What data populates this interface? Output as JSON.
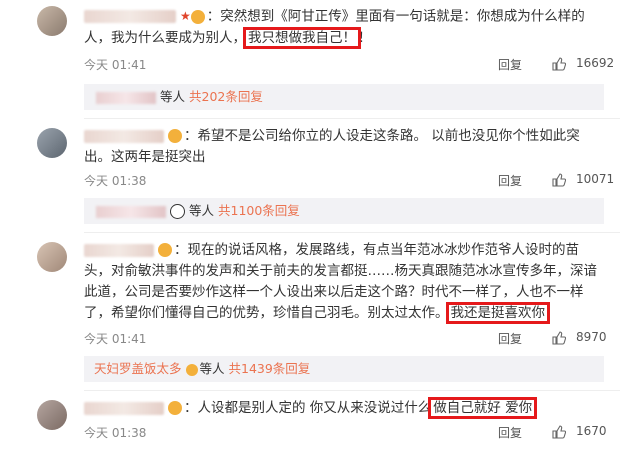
{
  "comments": [
    {
      "text_before": "突然想到《阿甘正传》里面有一句话就是：你想成为什么样的人，我为什么要成为别人，",
      "highlight": "我只想做我自己！",
      "text_after": "！",
      "time": "今天 01:41",
      "reply_label": "回复",
      "likes": "16692",
      "sub": {
        "suffix": "等人",
        "count_link": "共202条回复"
      }
    },
    {
      "text_before": "希望不是公司给你立的人设走这条路。 以前也没见你个性如此突出。这两年是挺突出",
      "highlight": "",
      "text_after": "",
      "time": "今天 01:38",
      "reply_label": "回复",
      "likes": "10071",
      "sub": {
        "suffix": "等人",
        "count_link": "共1100条回复"
      }
    },
    {
      "text_before": "现在的说话风格，发展路线，有点当年范冰冰炒作范爷人设时的苗头，对俞敏洪事件的发声和关于前夫的发言都挺……杨天真跟随范冰冰宣传多年，深谙此道，公司是否要炒作这样一个人设出来以后走这个路？时代不一样了，人也不一样了，希望你们懂得自己的优势，珍惜自己羽毛。别太过太作。",
      "highlight": "我还是挺喜欢你",
      "text_after": "",
      "time": "今天 01:41",
      "reply_label": "回复",
      "likes": "8970",
      "sub": {
        "name": "天妇罗盖饭太多",
        "suffix": "等人",
        "count_link": "共1439条回复"
      }
    },
    {
      "text_before": "人设都是别人定的 你又从来没说过什么",
      "highlight": "做自己就好 爱你",
      "text_after": "",
      "time": "今天 01:38",
      "reply_label": "回复",
      "likes": "1670"
    }
  ],
  "icons": {
    "like": "thumbs-up-icon",
    "badge": "vip-badge-icon",
    "star": "star-icon",
    "panda": "panda-emoji-icon"
  },
  "colors": {
    "highlight_box": "#e5191b",
    "link": "#eb7350",
    "sub_bg": "#f2f2f5"
  }
}
